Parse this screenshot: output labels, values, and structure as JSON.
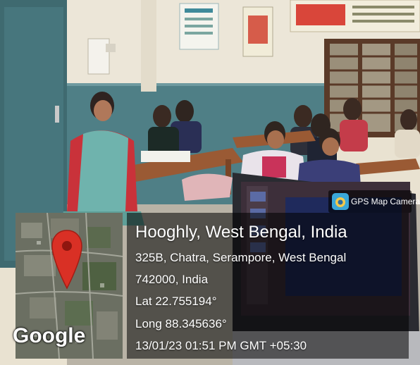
{
  "badge": {
    "label": "GPS Map Camera",
    "icon": "gps-map-camera-app-icon"
  },
  "map": {
    "provider_mark": "Google",
    "pin_icon": "map-pin-icon"
  },
  "location": {
    "title": "Hooghly, West Bengal, India",
    "address_line1": "325B, Chatra, Serampore, West Bengal",
    "address_line2": "742000, India",
    "latitude": "Lat 22.755194°",
    "longitude": "Long 88.345636°",
    "timestamp": "13/01/23 01:51 PM GMT +05:30"
  },
  "colors": {
    "pin": "#d93025",
    "wall_teal": "#4f7f86",
    "caption_bg": "#000000"
  }
}
